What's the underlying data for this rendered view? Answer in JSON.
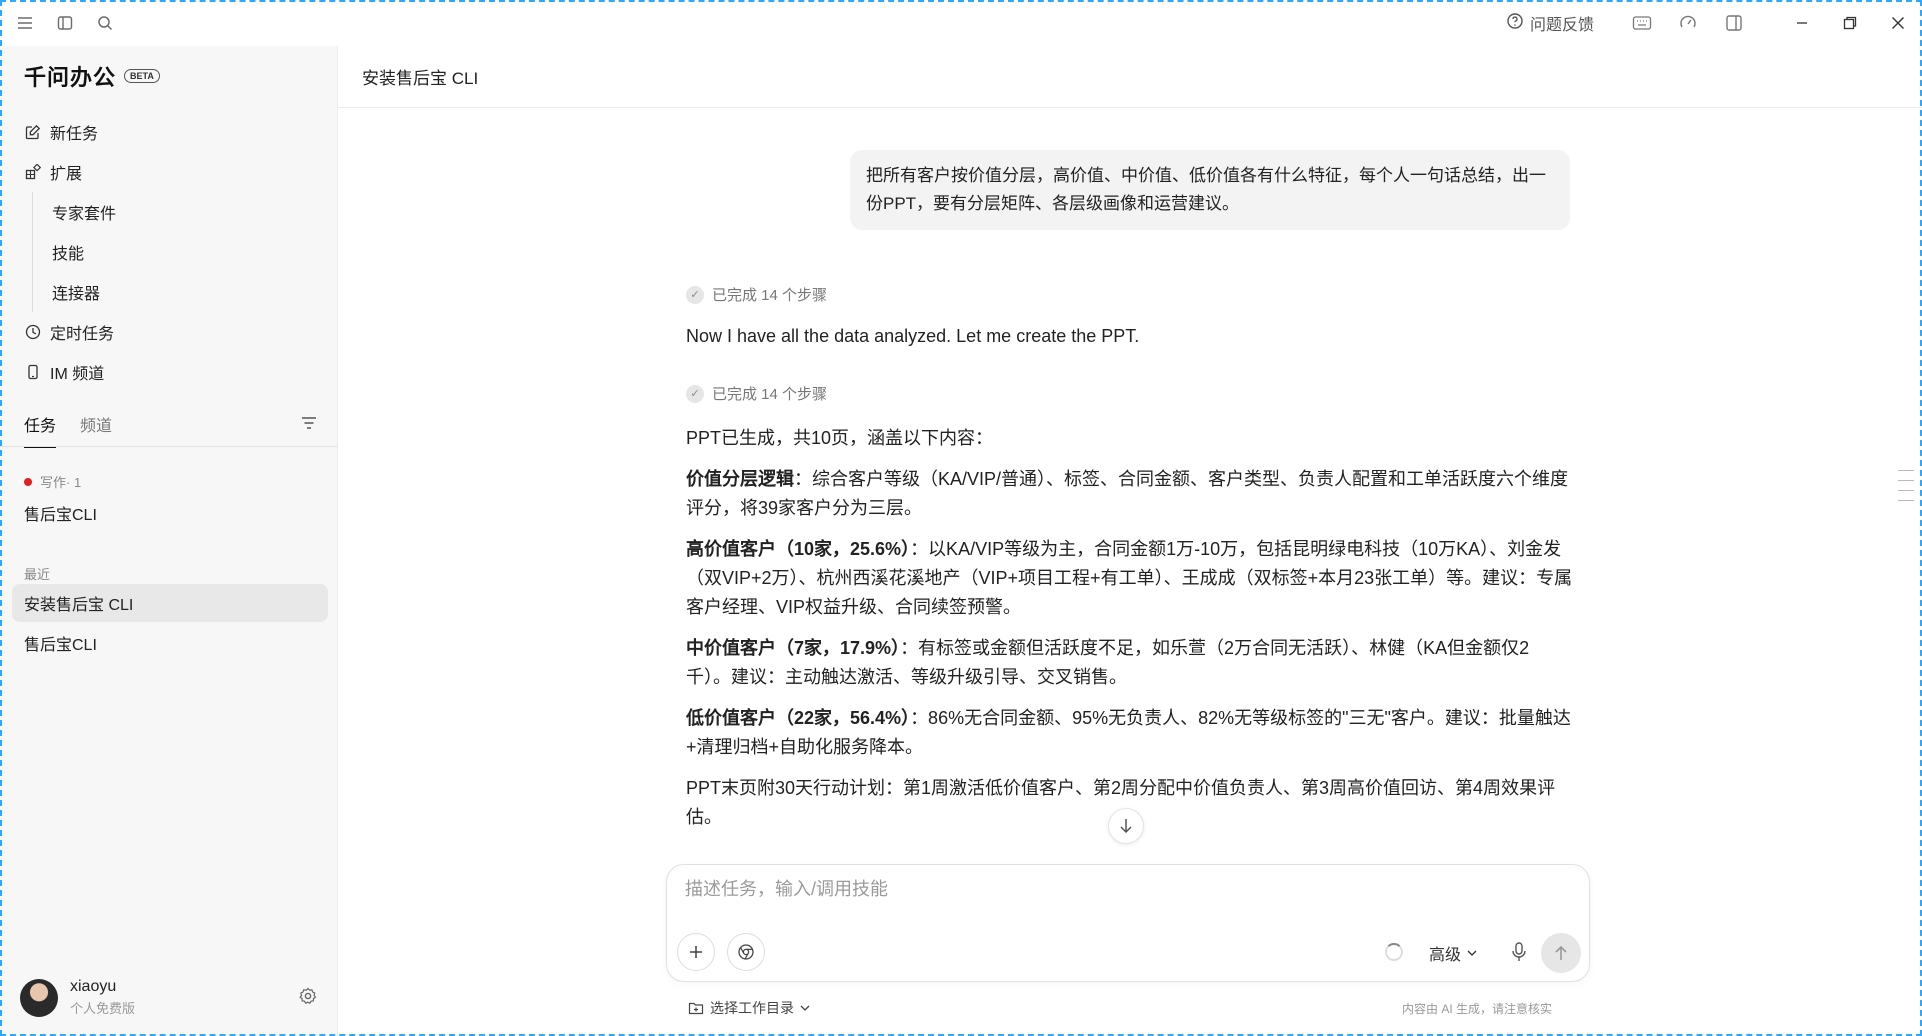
{
  "titlebar": {
    "feedback_label": "问题反馈",
    "icons": [
      "menu-icon",
      "sidebar-toggle-icon",
      "search-icon",
      "help-icon",
      "keyboard-icon",
      "gauge-icon",
      "split-view-icon",
      "minimize-icon",
      "restore-icon",
      "close-icon"
    ]
  },
  "sidebar": {
    "brand": "千问办公",
    "badge": "BETA",
    "nav": {
      "new_task": "新任务",
      "extensions": "扩展",
      "expert_suite": "专家套件",
      "skills": "技能",
      "connectors": "连接器",
      "scheduled": "定时任务",
      "im_channel": "IM 频道"
    },
    "tabs": {
      "tasks": "任务",
      "channels": "频道"
    },
    "writing_group": "写作· 1",
    "writing_task": "售后宝CLI",
    "recent_label": "最近",
    "recent": [
      "安装售后宝 CLI",
      "售后宝CLI"
    ],
    "user": {
      "name": "xiaoyu",
      "plan": "个人免费版"
    }
  },
  "main": {
    "title": "安装售后宝 CLI",
    "user_message": "把所有客户按价值分层，高价值、中价值、低价值各有什么特征，每个人一句话总结，出一份PPT，要有分层矩阵、各层级画像和运营建议。",
    "steps_1": "已完成 14 个步骤",
    "assistant_1": "Now I have all the data analyzed. Let me create the PPT.",
    "steps_2": "已完成 14 个步骤",
    "summary_intro": "PPT已生成，共10页，涵盖以下内容：",
    "p1_title": "价值分层逻辑",
    "p1_body": "：综合客户等级（KA/VIP/普通）、标签、合同金额、客户类型、负责人配置和工单活跃度六个维度评分，将39家客户分为三层。",
    "p2_title": "高价值客户（10家，25.6%）",
    "p2_body": "：以KA/VIP等级为主，合同金额1万-10万，包括昆明绿电科技（10万KA）、刘金发（双VIP+2万）、杭州西溪花溪地产（VIP+项目工程+有工单）、王成成（双标签+本月23张工单）等。建议：专属客户经理、VIP权益升级、合同续签预警。",
    "p3_title": "中价值客户（7家，17.9%）",
    "p3_body": "：有标签或金额但活跃度不足，如乐萱（2万合同无活跃）、林健（KA但金额仅2千）。建议：主动触达激活、等级升级引导、交叉销售。",
    "p4_title": "低价值客户（22家，56.4%）",
    "p4_body": "：86%无合同金额、95%无负责人、82%无等级标签的\"三无\"客户。建议：批量触达+清理归档+自助化服务降本。",
    "p5": "PPT末页附30天行动计划：第1周激活低价值客户、第2周分配中价值负责人、第3周高价值回访、第4周效果评估。"
  },
  "composer": {
    "placeholder": "描述任务，输入/调用技能",
    "mode": "高级",
    "workdir": "选择工作目录",
    "disclaimer": "内容由 AI 生成，请注意核实"
  }
}
